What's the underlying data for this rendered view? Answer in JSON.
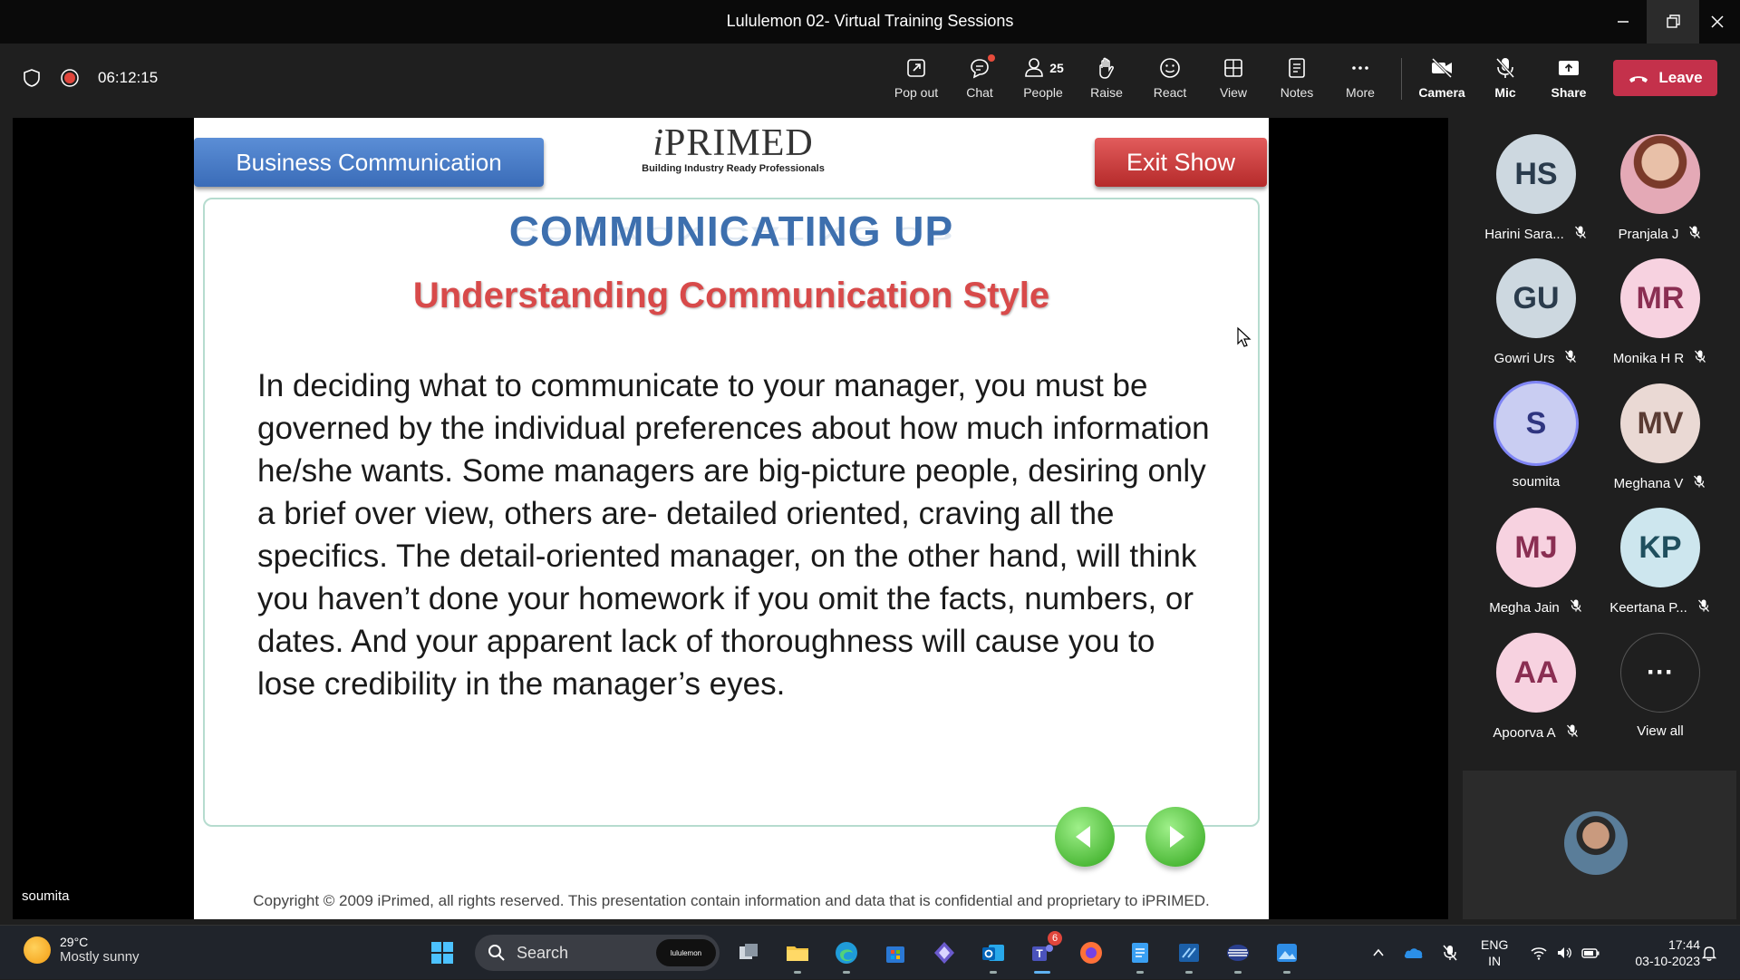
{
  "window": {
    "title": "Lululemon 02- Virtual Training Sessions"
  },
  "meeting": {
    "timer": "06:12:15",
    "toolbar": {
      "popout": "Pop out",
      "chat": "Chat",
      "people": "People",
      "people_count": "25",
      "raise": "Raise",
      "react": "React",
      "view": "View",
      "notes": "Notes",
      "more": "More",
      "camera": "Camera",
      "mic": "Mic",
      "share": "Share",
      "leave": "Leave"
    },
    "active_speaker_label": "soumita"
  },
  "slide": {
    "left_button": "Business Communication",
    "right_button": "Exit Show",
    "logo_brand_prefix": "i",
    "logo_brand_rest": "PRIMED",
    "logo_tagline": "Building Industry Ready Professionals",
    "heading": "COMMUNICATING UP",
    "subheading": "Understanding Communication Style",
    "body": "In deciding what to communicate to your manager, you must be governed by the individual preferences about how much information he/she wants. Some managers are big-picture people, desiring only a brief over view, others are- detailed oriented, craving all the specifics. The detail-oriented manager, on the other hand, will think you haven’t done your homework if you omit the facts, numbers, or dates. And your apparent lack of thoroughness will cause you to lose credibility in the manager’s eyes.",
    "copyright": "Copyright © 2009 iPrimed, all rights reserved. This presentation contain information  and data  that is confidential and proprietary to iPRIMED."
  },
  "participants": [
    {
      "initials": "HS",
      "name": "Harini Sara...",
      "muted": true,
      "bg": "#cdd8e0",
      "fg": "#2a3b4c",
      "photo": false
    },
    {
      "initials": "",
      "name": "Pranjala J",
      "muted": true,
      "bg": "#e4a9b6",
      "fg": "#fff",
      "photo": true
    },
    {
      "initials": "GU",
      "name": "Gowri Urs",
      "muted": true,
      "bg": "#cdd8e0",
      "fg": "#2a3b4c",
      "photo": false
    },
    {
      "initials": "MR",
      "name": "Monika H R",
      "muted": true,
      "bg": "#f7d2e0",
      "fg": "#8a2e52",
      "photo": false
    },
    {
      "initials": "S",
      "name": "soumita",
      "muted": false,
      "bg": "#c9cdf2",
      "fg": "#2f3580",
      "photo": false,
      "speaking": true
    },
    {
      "initials": "MV",
      "name": "Meghana V",
      "muted": true,
      "bg": "#ead9d4",
      "fg": "#5a3b33",
      "photo": false
    },
    {
      "initials": "MJ",
      "name": "Megha Jain",
      "muted": true,
      "bg": "#f7d2e0",
      "fg": "#8a2e52",
      "photo": false
    },
    {
      "initials": "KP",
      "name": "Keertana P...",
      "muted": true,
      "bg": "#cde6ee",
      "fg": "#1f4f5e",
      "photo": false
    },
    {
      "initials": "AA",
      "name": "Apoorva A",
      "muted": true,
      "bg": "#f7d2e0",
      "fg": "#8a2e52",
      "photo": false
    },
    {
      "initials": "···",
      "name": "View all",
      "muted": false,
      "bg": "#1f1f1f",
      "fg": "#fff",
      "photo": false,
      "viewall": true
    }
  ],
  "taskbar": {
    "weather_temp": "29°C",
    "weather_desc": "Mostly sunny",
    "search_placeholder": "Search",
    "search_pill": "lululemon",
    "teams_badge": "6",
    "lang_top": "ENG",
    "lang_bottom": "IN",
    "time": "17:44",
    "date": "03-10-2023"
  },
  "colors": {
    "leave": "#c4314b",
    "heading": "#3d6fae",
    "subheading": "#d84a4a",
    "accent": "#7f85f5"
  }
}
